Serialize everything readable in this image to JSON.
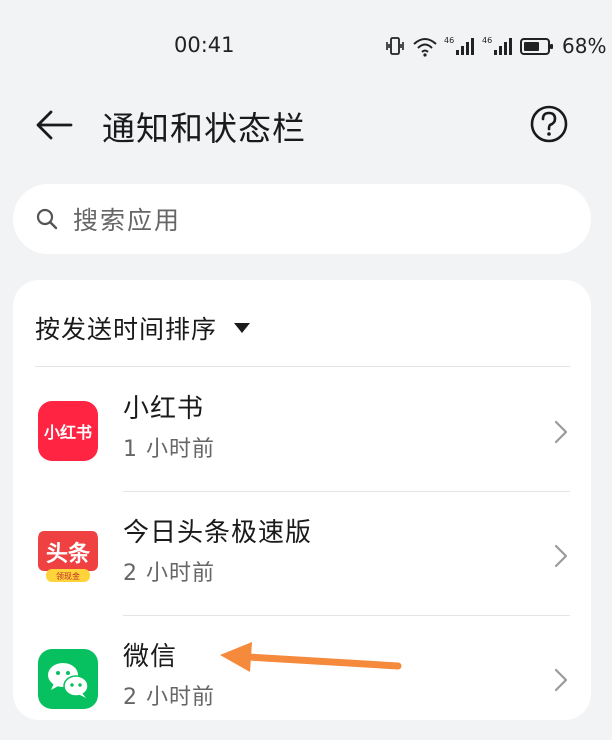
{
  "status_bar": {
    "time": "00:41",
    "net1": "46",
    "net2": "46",
    "battery_percent": "68%",
    "battery_level": 0.68,
    "icons": [
      "vibrate-icon",
      "wifi-icon",
      "signal-icon",
      "signal-icon",
      "battery-icon"
    ]
  },
  "header": {
    "title": "通知和状态栏",
    "back_icon": "back-arrow-icon",
    "help_icon": "help-icon"
  },
  "search": {
    "placeholder": "搜索应用"
  },
  "sort": {
    "label": "按发送时间排序"
  },
  "apps": [
    {
      "name": "小红书",
      "time": "1 小时前",
      "icon_text": "小红书",
      "icon_color": "#ff2442"
    },
    {
      "name": "今日头条极速版",
      "time": "2 小时前",
      "icon_text": "头条",
      "icon_subtext": "领现金",
      "icon_color": "#f04142"
    },
    {
      "name": "微信",
      "time": "2 小时前",
      "icon_color": "#07c160"
    }
  ],
  "colors": {
    "background": "#f1f3f5",
    "card": "#ffffff",
    "annotation_arrow": "#f5893c"
  }
}
